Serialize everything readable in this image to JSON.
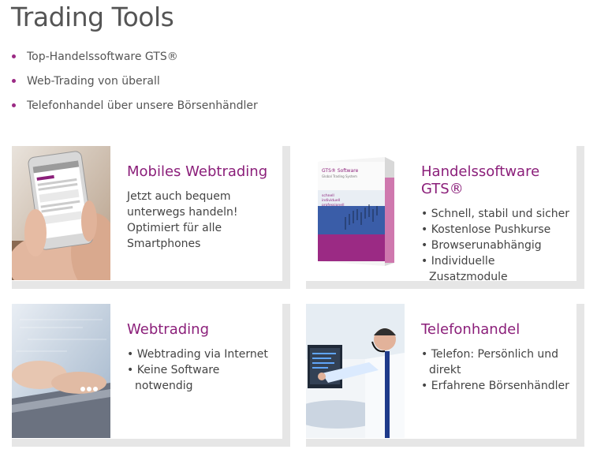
{
  "title": "Trading Tools",
  "bullets": [
    "Top-Handelssoftware GTS®",
    "Web-Trading von überall",
    "Telefonhandel über unsere Börsenhändler"
  ],
  "cards": [
    {
      "title": "Mobiles Webtrading",
      "description": "Jetzt auch bequem unterwegs handeln! Optimiert für alle Smartphones"
    },
    {
      "title": "Handelssoftware GTS®",
      "features": [
        "Schnell, stabil und sicher",
        "Kostenlose Pushkurse",
        "Browserunabhängig",
        "Individuelle Zusatzmodule"
      ],
      "box_label": "GTS® Software",
      "box_sublabel": "Global Trading System",
      "box_words": [
        "schnell",
        "individuell",
        "professionell"
      ]
    },
    {
      "title": "Webtrading",
      "features": [
        "Webtrading via Internet",
        "Keine Software notwendig"
      ]
    },
    {
      "title": "Telefonhandel",
      "features": [
        "Telefon: Persönlich und direkt",
        "Erfahrene Börsenhändler"
      ]
    }
  ],
  "colors": {
    "accent": "#8b1f7a",
    "bullet": "#9b2a84",
    "card_shadow": "#e6e6e6",
    "text": "#444444"
  }
}
